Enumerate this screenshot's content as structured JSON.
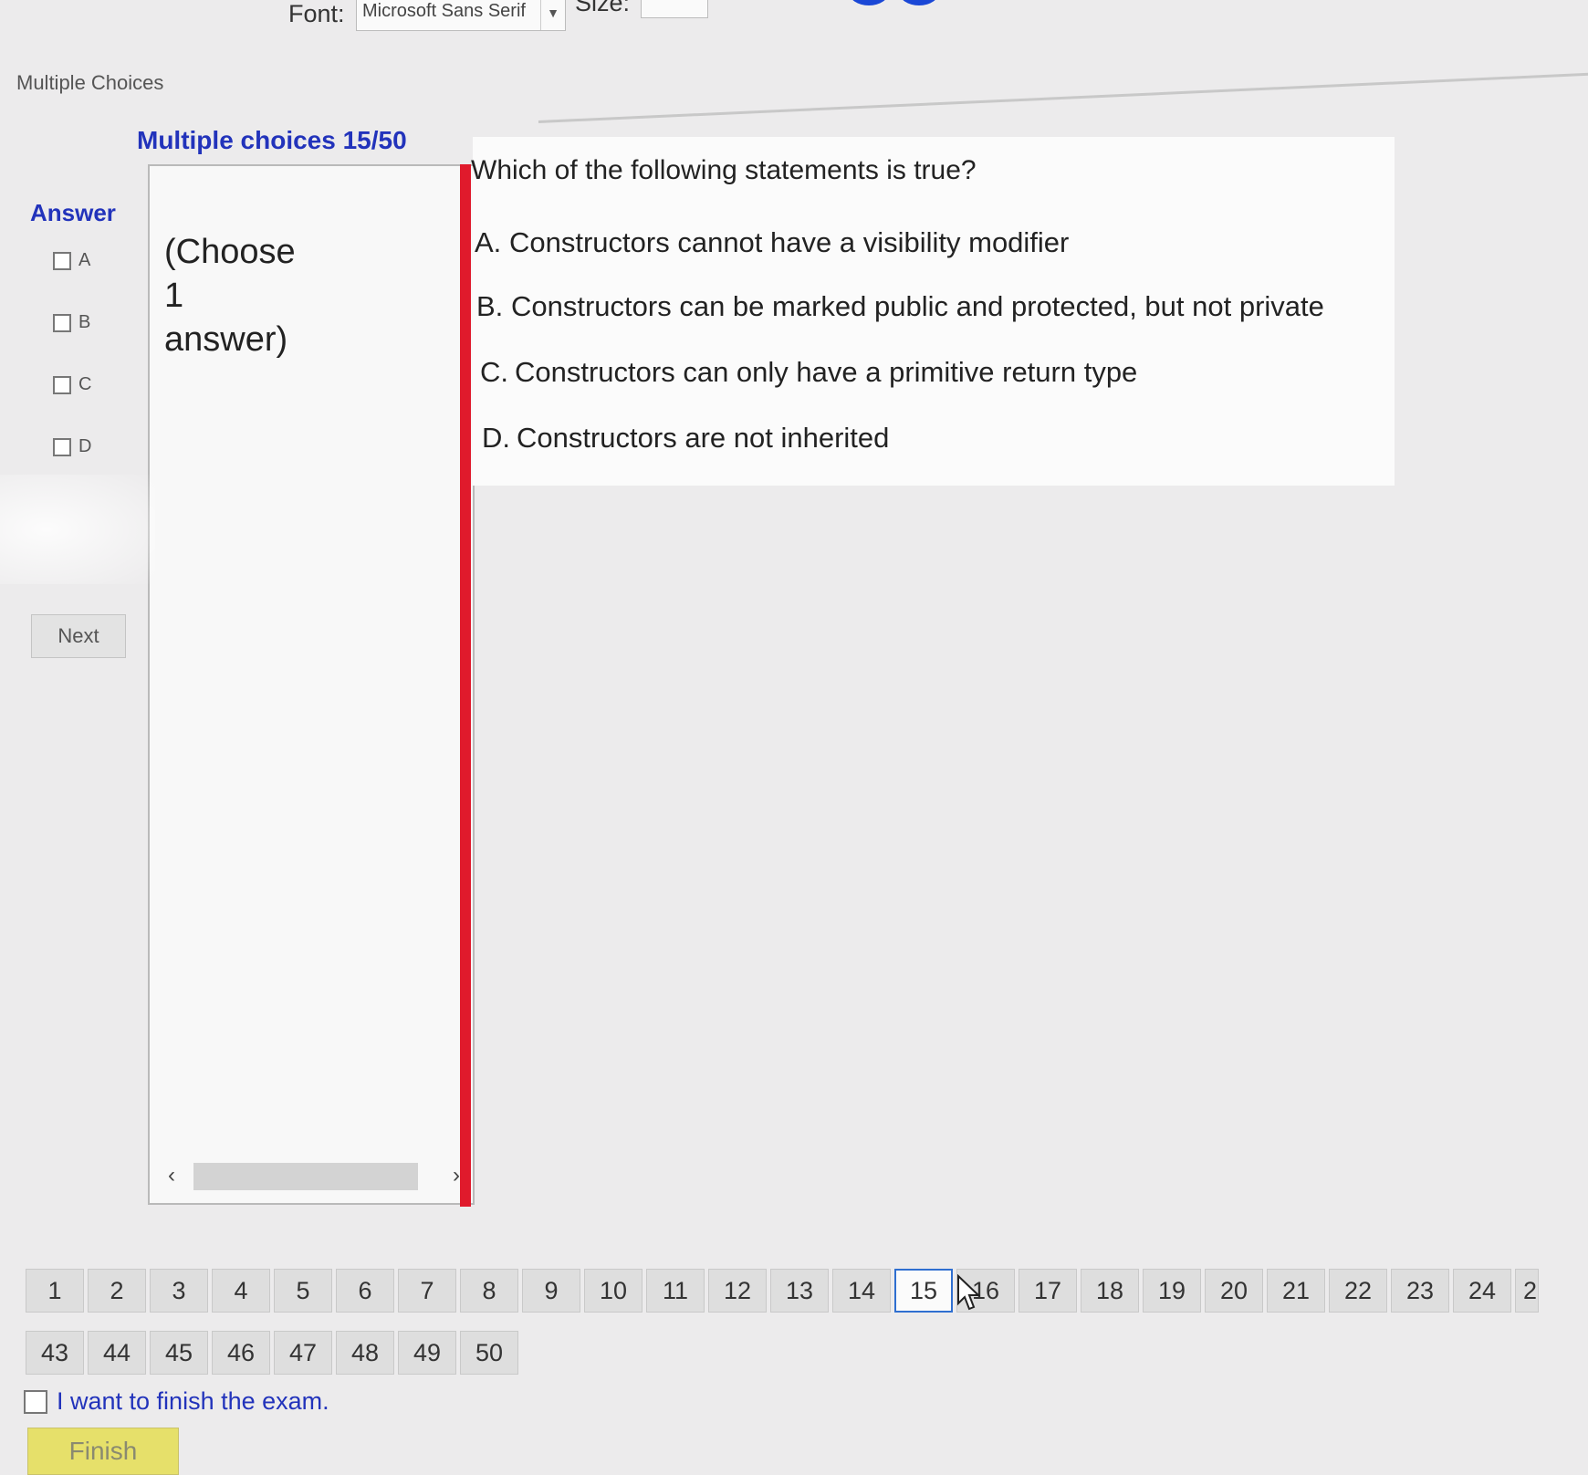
{
  "toolbar": {
    "font_label": "Font:",
    "font_value": "Microsoft Sans Serif",
    "size_label": "Size:"
  },
  "module_title": "Multiple Choices",
  "quiz": {
    "title": "Multiple choices 15/50",
    "instruction": "(Choose\n1\nanswer)",
    "question": "Which of the following statements is true?",
    "choices": [
      {
        "letter": "A.",
        "text": "Constructors cannot have a visibility modifier"
      },
      {
        "letter": "B.",
        "text": "Constructors can be marked public and protected, but not private"
      },
      {
        "letter": "C.",
        "text": "Constructors can only have a primitive return type"
      },
      {
        "letter": "D.",
        "text": "Constructors are not inherited"
      }
    ]
  },
  "answer": {
    "title": "Answer",
    "options": [
      "A",
      "B",
      "C",
      "D"
    ],
    "next_label": "Next"
  },
  "navigation": {
    "current_page": "15",
    "row1": [
      "1",
      "2",
      "3",
      "4",
      "5",
      "6",
      "7",
      "8",
      "9",
      "10",
      "11",
      "12",
      "13",
      "14",
      "15",
      "16",
      "17",
      "18",
      "19",
      "20",
      "21",
      "22",
      "23",
      "24",
      "2"
    ],
    "row2": [
      "43",
      "44",
      "45",
      "46",
      "47",
      "48",
      "49",
      "50"
    ]
  },
  "finish": {
    "checkbox_label": "I want to finish the exam.",
    "button_label": "Finish"
  },
  "colors": {
    "accent_blue": "#2233bb",
    "separator_red": "#e01a2c",
    "finish_yellow": "#e6e06a",
    "current_page_border": "#2f6fd0"
  }
}
